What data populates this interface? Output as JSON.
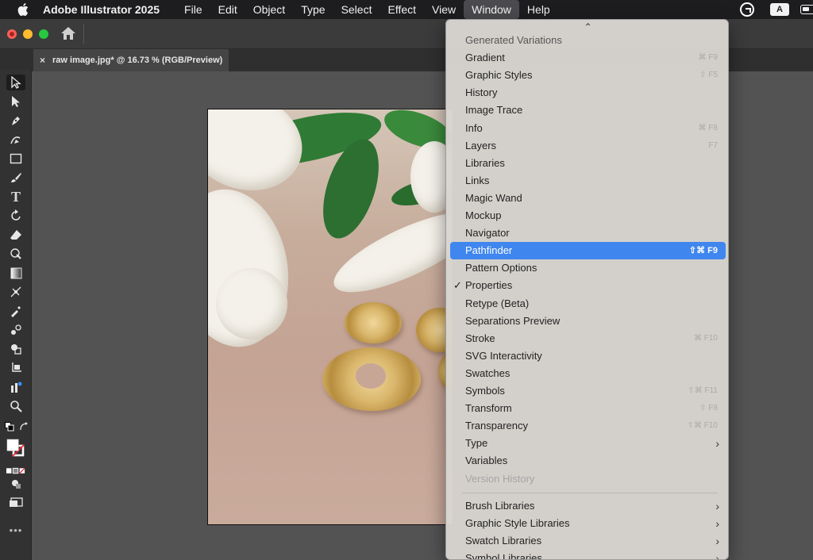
{
  "menubar": {
    "app_name": "Adobe Illustrator 2025",
    "items": [
      "File",
      "Edit",
      "Object",
      "Type",
      "Select",
      "Effect",
      "View",
      "Window",
      "Help"
    ],
    "active_item": "Window",
    "status_a_label": "A"
  },
  "document": {
    "tab_title": "raw image.jpg* @ 16.73 % (RGB/Preview)",
    "tab_close": "×",
    "panel_collapse": "››"
  },
  "tools": [
    "selection-tool",
    "direct-selection-tool",
    "pen-tool",
    "curvature-tool",
    "rectangle-tool",
    "paintbrush-tool",
    "type-tool",
    "rotate-tool",
    "eraser-tool",
    "puppet-warp-tool",
    "gradient-tool",
    "mesh-tool",
    "eyedropper-tool",
    "blend-tool",
    "shape-builder-tool",
    "artboard-tool",
    "chart-tool",
    "zoom-tool"
  ],
  "window_menu": {
    "scroll_indicator": "⌃",
    "items": [
      {
        "label": "Generated Variations",
        "shortcut": "",
        "state": "partial"
      },
      {
        "label": "Gradient",
        "shortcut": "⌘ F9"
      },
      {
        "label": "Graphic Styles",
        "shortcut": "⇧ F5"
      },
      {
        "label": "History",
        "shortcut": ""
      },
      {
        "label": "Image Trace",
        "shortcut": ""
      },
      {
        "label": "Info",
        "shortcut": "⌘ F8"
      },
      {
        "label": "Layers",
        "shortcut": "F7"
      },
      {
        "label": "Libraries",
        "shortcut": ""
      },
      {
        "label": "Links",
        "shortcut": ""
      },
      {
        "label": "Magic Wand",
        "shortcut": ""
      },
      {
        "label": "Mockup",
        "shortcut": ""
      },
      {
        "label": "Navigator",
        "shortcut": ""
      },
      {
        "label": "Pathfinder",
        "shortcut": "⇧⌘ F9",
        "state": "highlight"
      },
      {
        "label": "Pattern Options",
        "shortcut": ""
      },
      {
        "label": "Properties",
        "shortcut": "",
        "checked": "✓"
      },
      {
        "label": "Retype (Beta)",
        "shortcut": ""
      },
      {
        "label": "Separations Preview",
        "shortcut": ""
      },
      {
        "label": "Stroke",
        "shortcut": "⌘ F10"
      },
      {
        "label": "SVG Interactivity",
        "shortcut": ""
      },
      {
        "label": "Swatches",
        "shortcut": ""
      },
      {
        "label": "Symbols",
        "shortcut": "⇧⌘ F11"
      },
      {
        "label": "Transform",
        "shortcut": "⇧ F8"
      },
      {
        "label": "Transparency",
        "shortcut": "⇧⌘ F10"
      },
      {
        "label": "Type",
        "shortcut": "",
        "submenu": "›"
      },
      {
        "label": "Variables",
        "shortcut": ""
      },
      {
        "label": "Version History",
        "shortcut": "",
        "state": "disabled"
      }
    ],
    "library_items": [
      {
        "label": "Brush Libraries",
        "submenu": "›"
      },
      {
        "label": "Graphic Style Libraries",
        "submenu": "›"
      },
      {
        "label": "Swatch Libraries",
        "submenu": "›"
      },
      {
        "label": "Symbol Libraries",
        "submenu": "›"
      }
    ]
  }
}
